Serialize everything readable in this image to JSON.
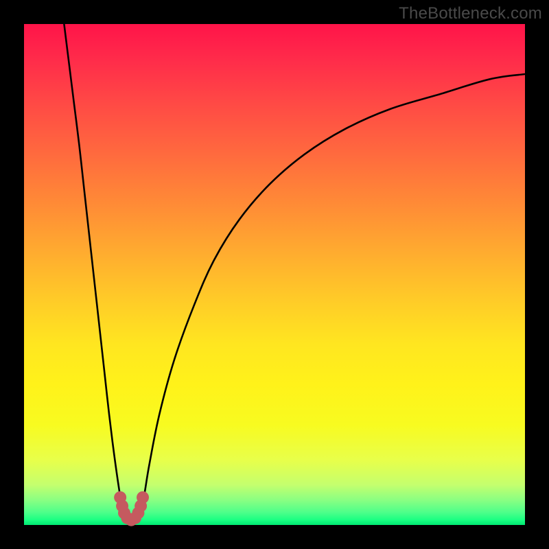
{
  "watermark": {
    "text": "TheBottleneck.com"
  },
  "colors": {
    "page_bg": "#000000",
    "curve_stroke": "#000000",
    "marker_fill": "#c55a5f",
    "gradient_stops": [
      "#ff1449",
      "#ff2b4a",
      "#ff4a45",
      "#ff6a3e",
      "#ff8b36",
      "#ffad2f",
      "#ffce27",
      "#ffe620",
      "#fff21a",
      "#f8fb20",
      "#e8ff4a",
      "#c4ff6e",
      "#8aff82",
      "#4dff8a",
      "#1aff82",
      "#00e873"
    ]
  },
  "chart_data": {
    "type": "line",
    "title": "",
    "xlabel": "",
    "ylabel": "",
    "xlim": [
      0,
      100
    ],
    "ylim": [
      0,
      100
    ],
    "grid": false,
    "legend": false,
    "annotations": [],
    "series": [
      {
        "name": "left-branch",
        "x": [
          8,
          9,
          10,
          11,
          12,
          13,
          14,
          15,
          16,
          17,
          18,
          19,
          20
        ],
        "y": [
          100,
          92,
          84,
          76,
          67,
          58,
          49,
          40,
          31,
          22,
          14,
          7,
          1
        ]
      },
      {
        "name": "right-branch",
        "x": [
          23,
          24,
          25,
          27,
          30,
          34,
          38,
          43,
          49,
          56,
          64,
          73,
          83,
          93,
          100
        ],
        "y": [
          1,
          6,
          12,
          22,
          33,
          44,
          53,
          61,
          68,
          74,
          79,
          83,
          86,
          89,
          90
        ]
      }
    ],
    "markers": {
      "name": "bottom-u-marker",
      "points": [
        {
          "x": 19.2,
          "y": 5.5
        },
        {
          "x": 19.6,
          "y": 3.8
        },
        {
          "x": 20.0,
          "y": 2.4
        },
        {
          "x": 20.6,
          "y": 1.4
        },
        {
          "x": 21.4,
          "y": 1.0
        },
        {
          "x": 22.2,
          "y": 1.4
        },
        {
          "x": 22.8,
          "y": 2.4
        },
        {
          "x": 23.3,
          "y": 3.8
        },
        {
          "x": 23.7,
          "y": 5.5
        }
      ]
    }
  }
}
